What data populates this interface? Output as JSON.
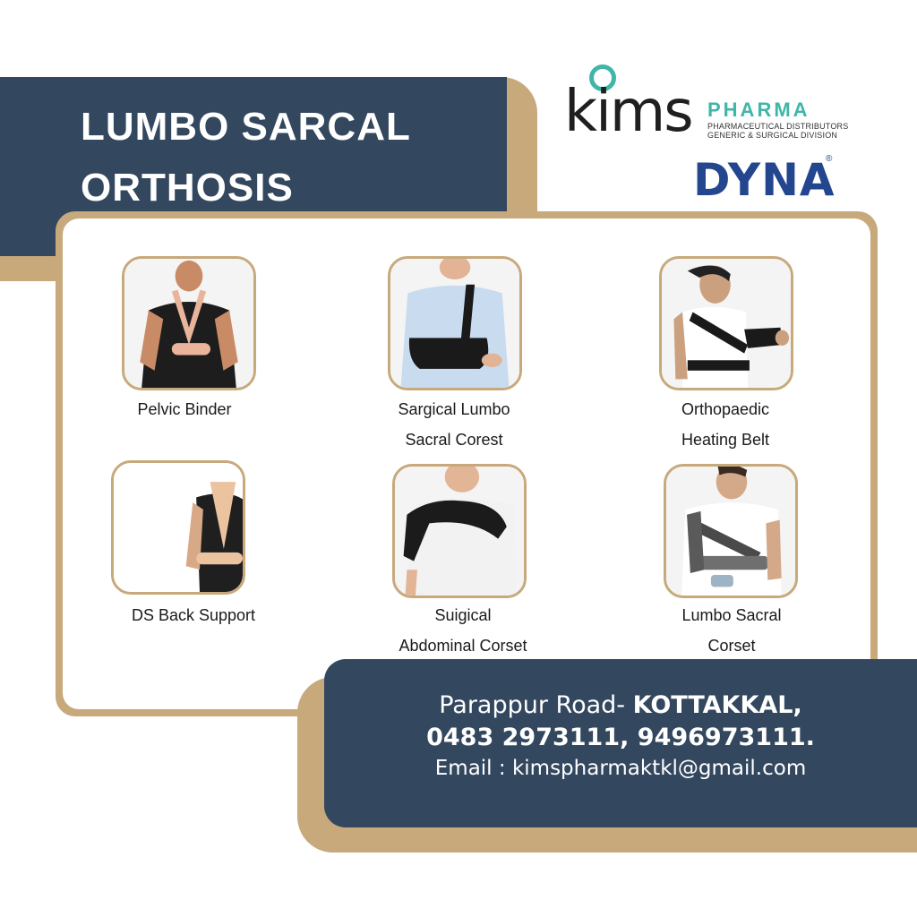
{
  "header": {
    "title_line1": "LUMBO SARCAL",
    "title_line2": "ORTHOSIS"
  },
  "logos": {
    "kims_word": "kims",
    "pharma_word": "PHARMA",
    "pharma_sub1": "PHARMACEUTICAL DISTRIBUTORS",
    "pharma_sub2": "GENERIC & SURGICAL DIVISION",
    "dyna": "DYNA",
    "dyna_reg": "®"
  },
  "products": [
    {
      "line1": "Pelvic Binder",
      "line2": ""
    },
    {
      "line1": "Sargical Lumbo",
      "line2": "Sacral Corest"
    },
    {
      "line1": "Orthopaedic",
      "line2": "Heating Belt"
    },
    {
      "line1": "DS Back Support",
      "line2": ""
    },
    {
      "line1": "Suigical",
      "line2": "Abdominal Corset"
    },
    {
      "line1": "Lumbo Sacral",
      "line2": "Corset"
    }
  ],
  "contact": {
    "address_prefix": "Parappur Road-",
    "address_city": "KOTTAKKAL,",
    "phones": "0483 2973111, 9496973111.",
    "email": "Email : kimspharmaktkl@gmail.com"
  },
  "colors": {
    "navy": "#33475f",
    "gold": "#c7a97c",
    "teal": "#3fb6a8",
    "dyna_blue": "#23468f"
  }
}
